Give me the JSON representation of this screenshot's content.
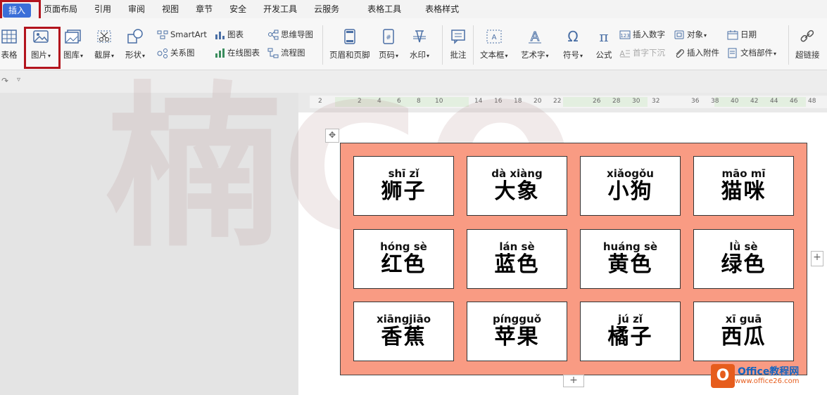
{
  "menu": {
    "items": [
      {
        "label": "插入",
        "active": true
      },
      {
        "label": "页面布局"
      },
      {
        "label": "引用"
      },
      {
        "label": "审阅"
      },
      {
        "label": "视图"
      },
      {
        "label": "章节"
      },
      {
        "label": "安全"
      },
      {
        "label": "开发工具"
      },
      {
        "label": "云服务"
      },
      {
        "label": "表格工具"
      },
      {
        "label": "表格样式"
      }
    ]
  },
  "ribbon": {
    "table": "表格",
    "picture": "图片",
    "gallery": "图库",
    "screenshot": "截屏",
    "shapes": "形状",
    "smartart": "SmartArt",
    "relation": "关系图",
    "chart": "图表",
    "online_chart": "在线图表",
    "mindmap": "思维导图",
    "flowchart": "流程图",
    "header_footer": "页眉和页脚",
    "page_number": "页码",
    "watermark": "水印",
    "comment": "批注",
    "textbox": "文本框",
    "wordart": "艺术字",
    "symbol": "符号",
    "formula": "公式",
    "insert_number": "插入数字",
    "drop_cap": "首字下沉",
    "object": "对象",
    "attachment": "插入附件",
    "date": "日期",
    "doc_parts": "文档部件",
    "hyperlink": "超链接"
  },
  "ruler": {
    "labels": [
      "2",
      "2",
      "4",
      "6",
      "8",
      "10",
      "14",
      "16",
      "18",
      "20",
      "22",
      "26",
      "28",
      "30",
      "32",
      "36",
      "38",
      "40",
      "42",
      "44",
      "46",
      "48"
    ]
  },
  "grid": [
    [
      {
        "pinyin": "shī  zǐ",
        "hanzi": "狮子"
      },
      {
        "pinyin": "dà xiàng",
        "hanzi": "大象"
      },
      {
        "pinyin": "xiǎogǒu",
        "hanzi": "小狗"
      },
      {
        "pinyin": "māo mī",
        "hanzi": "猫咪"
      }
    ],
    [
      {
        "pinyin": "hóng sè",
        "hanzi": "红色"
      },
      {
        "pinyin": "lán  sè",
        "hanzi": "蓝色"
      },
      {
        "pinyin": "huáng sè",
        "hanzi": "黄色"
      },
      {
        "pinyin": "lǜ   sè",
        "hanzi": "绿色"
      }
    ],
    [
      {
        "pinyin": "xiāngjiāo",
        "hanzi": "香蕉"
      },
      {
        "pinyin": "píngguǒ",
        "hanzi": "苹果"
      },
      {
        "pinyin": "jú  zǐ",
        "hanzi": "橘子"
      },
      {
        "pinyin": "xī  guā",
        "hanzi": "西瓜"
      }
    ]
  ],
  "watermark": {
    "text": "楠GO"
  },
  "logo": {
    "letter": "O",
    "name": "Office教程网",
    "url": "www.office26.com"
  },
  "colors": {
    "table_bg": "#f99b83",
    "accent": "#3b6fd8",
    "highlight_box": "#b3141d"
  }
}
